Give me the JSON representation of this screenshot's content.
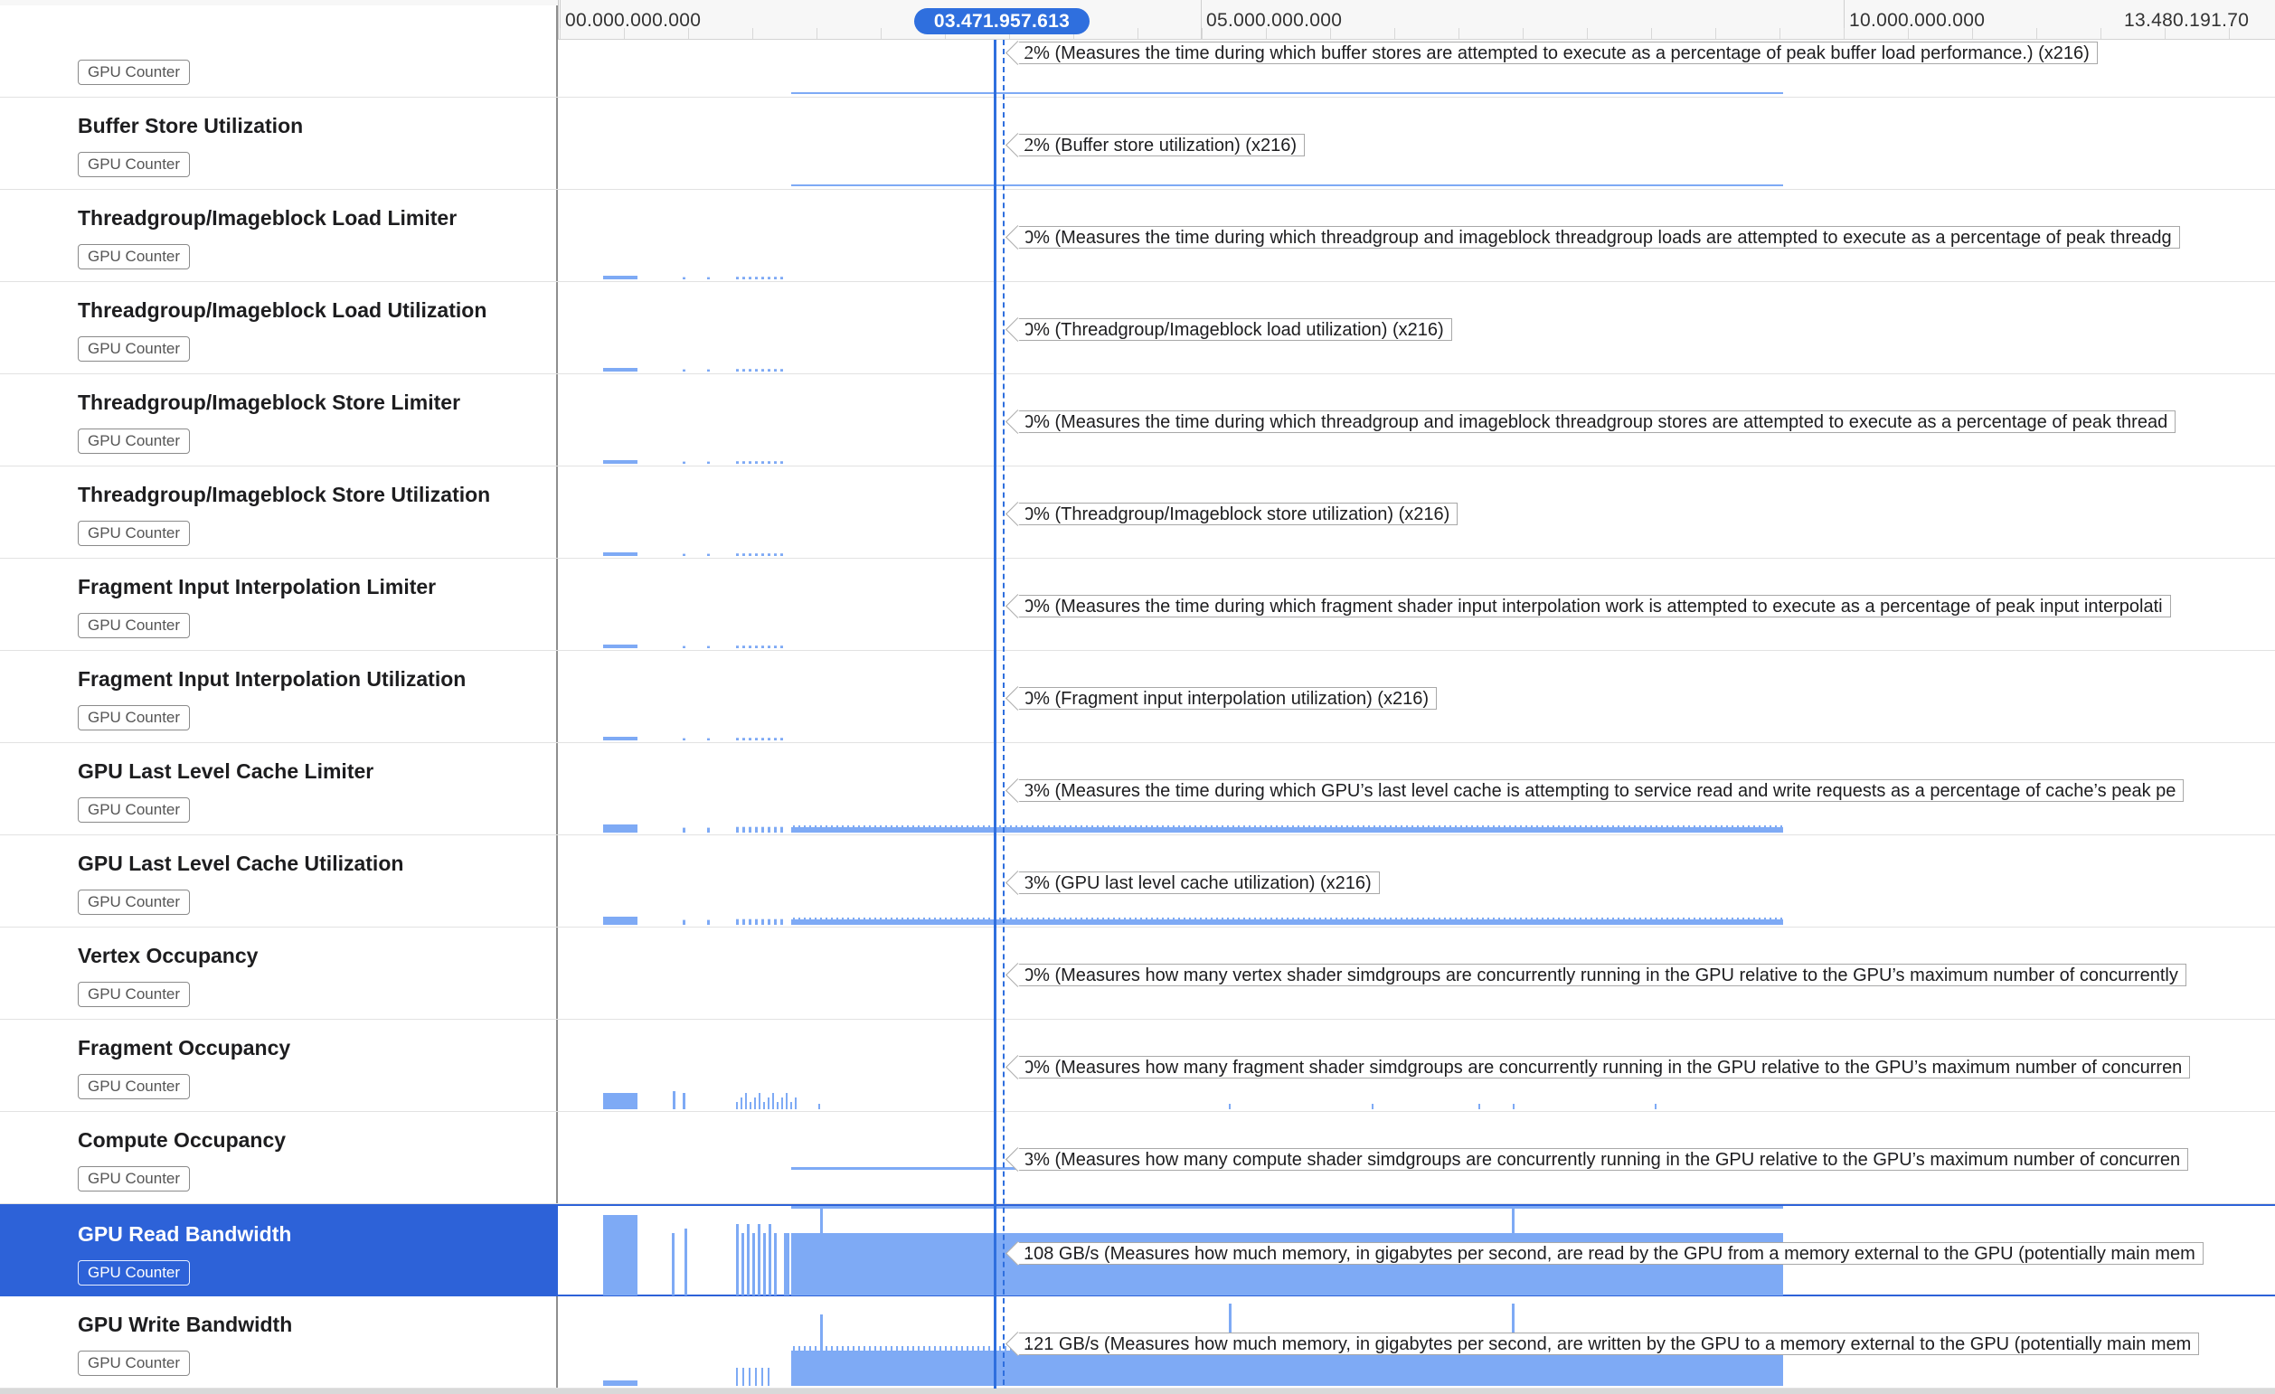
{
  "timeline": {
    "ruler_labels": [
      {
        "text": "00.000.000.000"
      },
      {
        "text": "05.000.000.000"
      },
      {
        "text": "10.000.000.000"
      },
      {
        "text": "13.480.191.70"
      }
    ],
    "playhead_time": "03.471.957.613"
  },
  "colors": {
    "selection": "#2d62d8",
    "graph_fill": "#7eaaf5",
    "playhead": "#2f6fde"
  },
  "tracks": [
    {
      "id": "t0",
      "name": "",
      "badge": "GPU Counter",
      "pattern": "thin",
      "tooltip": "2% (Measures the time during which buffer stores are attempted to execute as a percentage of peak buffer load performance.) (x216)"
    },
    {
      "id": "t1",
      "name": "Buffer Store Utilization",
      "badge": "GPU Counter",
      "pattern": "thin",
      "tooltip": "2% (Buffer store utilization) (x216)"
    },
    {
      "id": "t2",
      "name": "Threadgroup/Imageblock Load Limiter",
      "badge": "GPU Counter",
      "pattern": "early",
      "tooltip": "0% (Measures the time during which threadgroup and imageblock threadgroup loads are attempted to execute as a percentage of peak threadg"
    },
    {
      "id": "t3",
      "name": "Threadgroup/Imageblock Load Utilization",
      "badge": "GPU Counter",
      "pattern": "early",
      "tooltip": "0% (Threadgroup/Imageblock load utilization) (x216)"
    },
    {
      "id": "t4",
      "name": "Threadgroup/Imageblock Store Limiter",
      "badge": "GPU Counter",
      "pattern": "early",
      "tooltip": "0% (Measures the time during which threadgroup and imageblock threadgroup stores are attempted to execute as a percentage of peak thread"
    },
    {
      "id": "t5",
      "name": "Threadgroup/Imageblock Store Utilization",
      "badge": "GPU Counter",
      "pattern": "early",
      "tooltip": "0% (Threadgroup/Imageblock store utilization) (x216)"
    },
    {
      "id": "t6",
      "name": "Fragment Input Interpolation Limiter",
      "badge": "GPU Counter",
      "pattern": "early",
      "tooltip": "0% (Measures the time during which fragment shader input interpolation work is attempted to execute as a percentage of peak input interpolati"
    },
    {
      "id": "t7",
      "name": "Fragment Input Interpolation Utilization",
      "badge": "GPU Counter",
      "pattern": "early",
      "tooltip": "0% (Fragment input interpolation utilization) (x216)"
    },
    {
      "id": "t8",
      "name": "GPU Last Level Cache Limiter",
      "badge": "GPU Counter",
      "pattern": "cache",
      "tooltip": "8% (Measures the time during which GPU’s last level cache is attempting to service read and write requests as a percentage of cache’s peak pe"
    },
    {
      "id": "t9",
      "name": "GPU Last Level Cache Utilization",
      "badge": "GPU Counter",
      "pattern": "cache",
      "tooltip": "8% (GPU last level cache utilization) (x216)"
    },
    {
      "id": "t10",
      "name": "Vertex Occupancy",
      "badge": "GPU Counter",
      "pattern": "none",
      "tooltip": "0% (Measures how many vertex shader simdgroups are concurrently running in the GPU relative to the GPU’s maximum number of concurrently"
    },
    {
      "id": "t11",
      "name": "Fragment Occupancy",
      "badge": "GPU Counter",
      "pattern": "fragocc",
      "tooltip": "0% (Measures how many fragment shader simdgroups are concurrently running in the GPU relative to the GPU’s maximum number of concurren"
    },
    {
      "id": "t12",
      "name": "Compute Occupancy",
      "badge": "GPU Counter",
      "pattern": "compute",
      "tooltip": "3% (Measures how many compute shader simdgroups are concurrently running in the GPU relative to the GPU’s maximum number of concurren"
    },
    {
      "id": "t13",
      "name": "GPU Read Bandwidth",
      "badge": "GPU Counter",
      "pattern": "read",
      "selected": true,
      "tooltip": "108 GB/s (Measures how much memory, in gigabytes per second, are read by the GPU from a memory external to the GPU (potentially main mem"
    },
    {
      "id": "t14",
      "name": "GPU Write Bandwidth",
      "badge": "GPU Counter",
      "pattern": "write",
      "tooltip": "121 GB/s (Measures how much memory, in gigabytes per second, are written by the GPU to a memory external to the GPU (potentially main mem"
    }
  ]
}
